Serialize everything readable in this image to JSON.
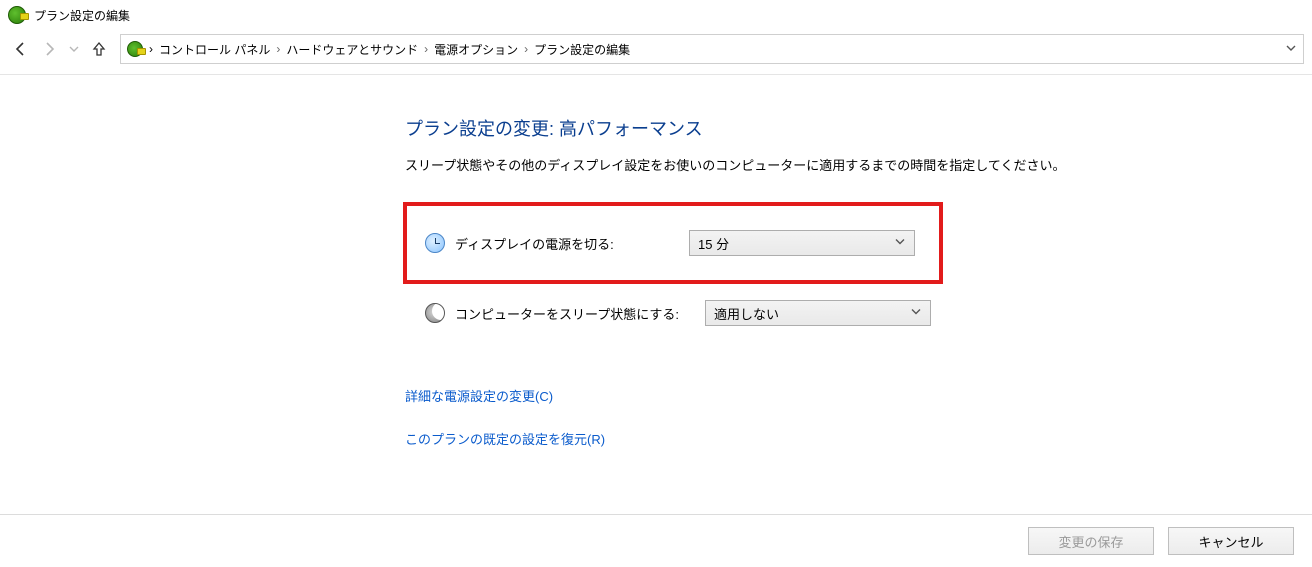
{
  "window": {
    "title": "プラン設定の編集"
  },
  "breadcrumb": {
    "items": [
      "コントロール パネル",
      "ハードウェアとサウンド",
      "電源オプション",
      "プラン設定の編集"
    ]
  },
  "page": {
    "heading": "プラン設定の変更: 高パフォーマンス",
    "subtext": "スリープ状態やその他のディスプレイ設定をお使いのコンピューターに適用するまでの時間を指定してください。"
  },
  "settings": {
    "display_off": {
      "label": "ディスプレイの電源を切る:",
      "value": "15 分"
    },
    "sleep": {
      "label": "コンピューターをスリープ状態にする:",
      "value": "適用しない"
    }
  },
  "links": {
    "advanced": "詳細な電源設定の変更(C)",
    "restore": "このプランの既定の設定を復元(R)"
  },
  "buttons": {
    "save": "変更の保存",
    "cancel": "キャンセル"
  }
}
